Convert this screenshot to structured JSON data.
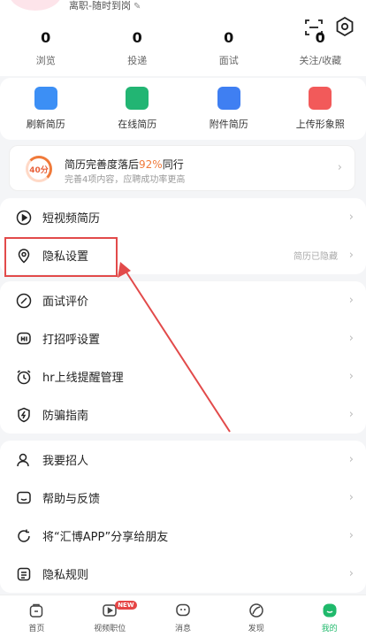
{
  "profile": {
    "status": "离职-随时到岗"
  },
  "stats": [
    {
      "value": "0",
      "label": "浏览"
    },
    {
      "value": "0",
      "label": "投递"
    },
    {
      "value": "0",
      "label": "面试"
    },
    {
      "value": "0",
      "label": "关注/收藏"
    }
  ],
  "quick": [
    {
      "label": "刷新简历",
      "icon": "refresh-icon",
      "color": "#3c8ff5"
    },
    {
      "label": "在线简历",
      "icon": "online-resume-icon",
      "color": "#22b573"
    },
    {
      "label": "附件简历",
      "icon": "attachment-icon",
      "color": "#3f7ff2"
    },
    {
      "label": "上传形象照",
      "icon": "photo-icon",
      "color": "#f25a5a"
    }
  ],
  "resume_progress": {
    "score": "40分",
    "title_prefix": "简历完善度落后",
    "percent": "92%",
    "title_suffix": "同行",
    "subtitle": "完善4项内容，应聘成功率更高"
  },
  "group1": [
    {
      "label": "短视频简历",
      "icon": "play-circle-icon",
      "value": ""
    },
    {
      "label": "隐私设置",
      "icon": "privacy-pin-icon",
      "value": "简历已隐藏"
    }
  ],
  "group2": [
    {
      "label": "面试评价",
      "icon": "review-icon"
    },
    {
      "label": "打招呼设置",
      "icon": "greeting-icon"
    },
    {
      "label": "hr上线提醒管理",
      "icon": "alarm-icon"
    },
    {
      "label": "防骗指南",
      "icon": "shield-icon"
    }
  ],
  "group3": [
    {
      "label": "我要招人",
      "icon": "recruit-icon"
    },
    {
      "label": "帮助与反馈",
      "icon": "feedback-icon"
    },
    {
      "label": "将“汇博APP”分享给朋友",
      "icon": "share-icon"
    },
    {
      "label": "隐私规则",
      "icon": "rules-icon"
    }
  ],
  "tabs": [
    {
      "label": "首页",
      "icon": "home-icon"
    },
    {
      "label": "视频职位",
      "icon": "video-icon",
      "badge": "NEW"
    },
    {
      "label": "消息",
      "icon": "message-icon"
    },
    {
      "label": "发现",
      "icon": "discover-icon"
    },
    {
      "label": "我的",
      "icon": "me-icon",
      "active": true
    }
  ],
  "colors": {
    "accent": "#1fb96b",
    "highlight": "#e24a4a",
    "progress": "#f07a3a"
  },
  "annotation": {
    "shape": "red box with arrow",
    "target": "隐私设置"
  }
}
